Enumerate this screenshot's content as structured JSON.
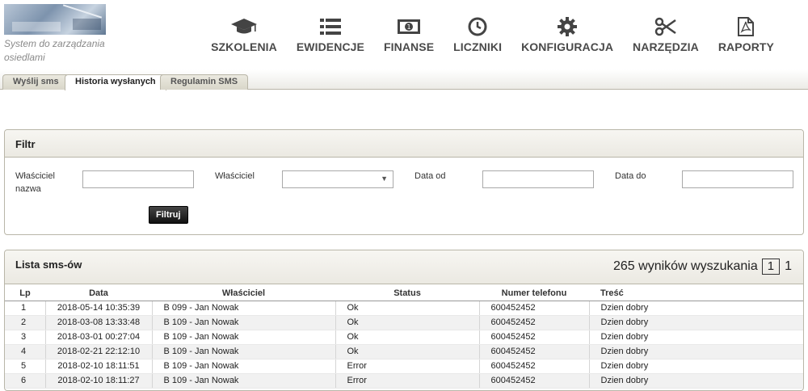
{
  "app": {
    "logo_text": "System do zarządzania osiedlami"
  },
  "nav": [
    {
      "label": "SZKOLENIA",
      "icon": "graduation-cap-icon"
    },
    {
      "label": "EWIDENCJE",
      "icon": "list-icon"
    },
    {
      "label": "FINANSE",
      "icon": "money-icon"
    },
    {
      "label": "LICZNIKI",
      "icon": "clock-icon"
    },
    {
      "label": "KONFIGURACJA",
      "icon": "gear-icon"
    },
    {
      "label": "NARZĘDZIA",
      "icon": "scissors-icon"
    },
    {
      "label": "RAPORTY",
      "icon": "pdf-file-icon"
    }
  ],
  "tabs": [
    {
      "label": "Wyślij sms",
      "active": false
    },
    {
      "label": "Historia wysłanych",
      "active": true
    },
    {
      "label": "Regulamin SMS",
      "active": false
    }
  ],
  "filter": {
    "title": "Filtr",
    "owner_name_label": "Właściciel nazwa",
    "owner_name_value": "",
    "owner_label": "Właściciel",
    "owner_selected": "",
    "date_from_label": "Data od",
    "date_from_value": "",
    "date_to_label": "Data do",
    "date_to_value": "",
    "submit_label": "Filtruj"
  },
  "list": {
    "title": "Lista sms-ów",
    "results_text": "265 wyników wyszukania",
    "current_page": "1",
    "total_pages": "1",
    "columns": [
      "Lp",
      "Data",
      "Właściciel",
      "Status",
      "Numer telefonu",
      "Treść"
    ],
    "rows": [
      {
        "lp": "1",
        "date": "2018-05-14 10:35:39",
        "owner": "B 099 - Jan Nowak",
        "status": "Ok",
        "phone": "600452452",
        "text": "Dzien dobry"
      },
      {
        "lp": "2",
        "date": "2018-03-08 13:33:48",
        "owner": "B 109 - Jan Nowak",
        "status": "Ok",
        "phone": "600452452",
        "text": "Dzien dobry"
      },
      {
        "lp": "3",
        "date": "2018-03-01 00:27:04",
        "owner": "B 109 - Jan Nowak",
        "status": "Ok",
        "phone": "600452452",
        "text": "Dzien dobry"
      },
      {
        "lp": "4",
        "date": "2018-02-21 22:12:10",
        "owner": "B 109 - Jan Nowak",
        "status": "Ok",
        "phone": "600452452",
        "text": "Dzien dobry"
      },
      {
        "lp": "5",
        "date": "2018-02-10 18:11:51",
        "owner": "B 109 - Jan Nowak",
        "status": "Error",
        "phone": "600452452",
        "text": "Dzien dobry"
      },
      {
        "lp": "6",
        "date": "2018-02-10 18:11:27",
        "owner": "B 109 - Jan Nowak",
        "status": "Error",
        "phone": "600452452",
        "text": "Dzien dobry"
      }
    ]
  }
}
